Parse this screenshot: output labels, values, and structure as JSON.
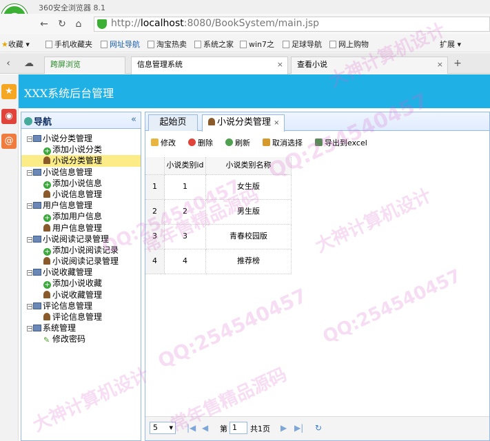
{
  "browser": {
    "title": "360安全浏览器 8.1",
    "url_host": "localhost",
    "url_rest": ":8080/BookSystem/main.jsp",
    "url_prefix": "http://"
  },
  "bookmarks": [
    {
      "label": "收藏"
    },
    {
      "label": "手机收藏夹"
    },
    {
      "label": "网址导航"
    },
    {
      "label": "淘宝热卖"
    },
    {
      "label": "系统之家"
    },
    {
      "label": "win7之"
    },
    {
      "label": "足球导航"
    },
    {
      "label": "网上购物"
    },
    {
      "label": "扩展"
    }
  ],
  "browser_tabs": [
    {
      "label": "跨屏浏览"
    },
    {
      "label": "信息管理系统"
    },
    {
      "label": "查看小说"
    }
  ],
  "banner": {
    "title": "XXX系统后台管理"
  },
  "nav": {
    "title": "导航",
    "tree": [
      {
        "label": "小说分类管理",
        "kind": "group"
      },
      {
        "label": "添加小说分类",
        "kind": "add"
      },
      {
        "label": "小说分类管理",
        "kind": "user",
        "selected": true
      },
      {
        "label": "小说信息管理",
        "kind": "group"
      },
      {
        "label": "添加小说信息",
        "kind": "add"
      },
      {
        "label": "小说信息管理",
        "kind": "user"
      },
      {
        "label": "用户信息管理",
        "kind": "group"
      },
      {
        "label": "添加用户信息",
        "kind": "add"
      },
      {
        "label": "用户信息管理",
        "kind": "user"
      },
      {
        "label": "小说阅读记录管理",
        "kind": "group"
      },
      {
        "label": "添加小说阅读记录",
        "kind": "add"
      },
      {
        "label": "小说阅读记录管理",
        "kind": "user"
      },
      {
        "label": "小说收藏管理",
        "kind": "group"
      },
      {
        "label": "添加小说收藏",
        "kind": "add"
      },
      {
        "label": "小说收藏管理",
        "kind": "user"
      },
      {
        "label": "评论信息管理",
        "kind": "group"
      },
      {
        "label": "评论信息管理",
        "kind": "user"
      },
      {
        "label": "系统管理",
        "kind": "group"
      },
      {
        "label": "修改密码",
        "kind": "pen"
      }
    ]
  },
  "main_tabs": [
    {
      "label": "起始页"
    },
    {
      "label": "小说分类管理"
    }
  ],
  "toolbar": {
    "edit": "修改",
    "delete": "删除",
    "refresh": "刷新",
    "cancel_select": "取消选择",
    "export": "导出到excel"
  },
  "grid": {
    "columns": [
      "小说类别id",
      "小说类别名称"
    ],
    "rows": [
      {
        "rownum": "1",
        "id": "1",
        "name": "女生版"
      },
      {
        "rownum": "2",
        "id": "2",
        "name": "男生版"
      },
      {
        "rownum": "3",
        "id": "3",
        "name": "青春校园版"
      },
      {
        "rownum": "4",
        "id": "4",
        "name": "推荐榜"
      }
    ]
  },
  "pager": {
    "page_size": "5",
    "page_label": "第",
    "page_value": "1",
    "total": "共1页"
  },
  "watermarks": [
    {
      "text": "QQ:254540457"
    },
    {
      "text": "大神计算机设计"
    },
    {
      "text": "常年售精品源码"
    }
  ],
  "colors": {
    "banner": "#1fb0e6",
    "panel_border": "#95b8e7",
    "selected": "#fbec88"
  }
}
